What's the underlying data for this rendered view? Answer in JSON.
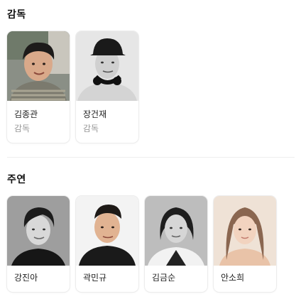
{
  "sections": {
    "directors": {
      "title": "감독",
      "people": [
        {
          "name": "김종관",
          "role": "감독"
        },
        {
          "name": "장건재",
          "role": "감독"
        }
      ]
    },
    "cast": {
      "title": "주연",
      "people": [
        {
          "name": "강진아"
        },
        {
          "name": "곽민규"
        },
        {
          "name": "김금순"
        },
        {
          "name": "안소희"
        }
      ]
    }
  },
  "colors": {
    "name_text": "#222222",
    "role_text": "#999999",
    "card_border": "#ececec",
    "divider": "#eeeeee"
  }
}
